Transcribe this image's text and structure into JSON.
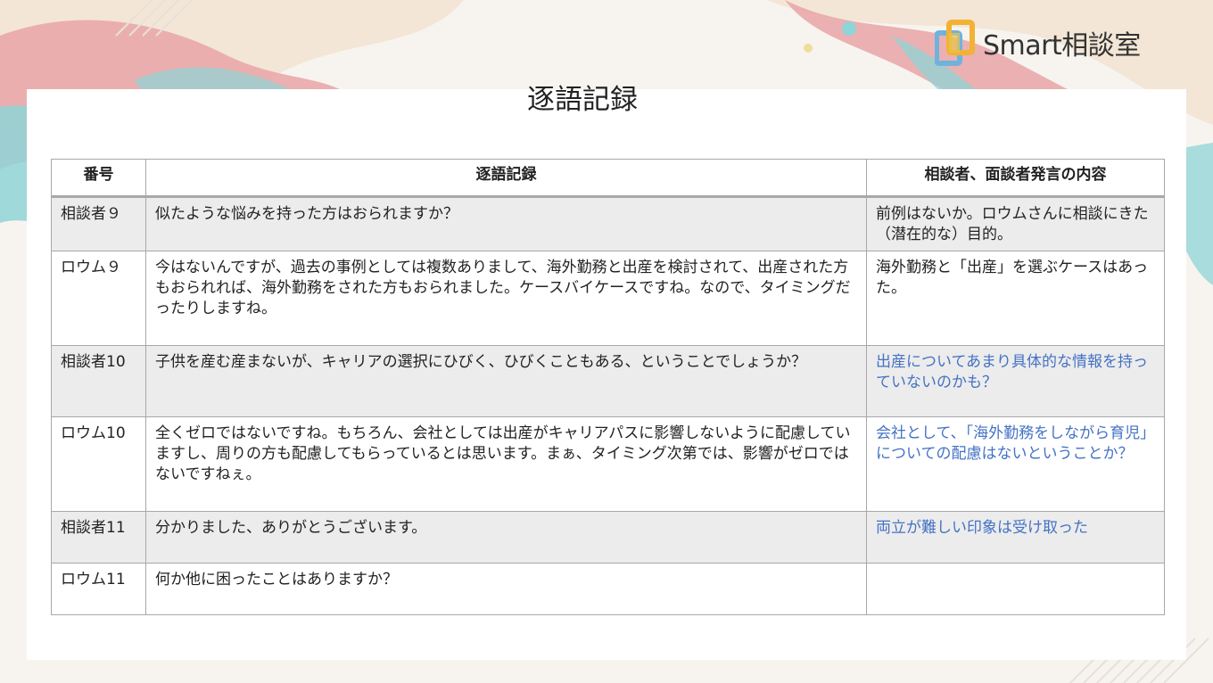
{
  "brand": {
    "name": "Smart相談室"
  },
  "page": {
    "title": "逐語記録"
  },
  "table": {
    "headers": [
      "番号",
      "逐語記録",
      "相談者、面談者発言の内容"
    ],
    "rows": [
      {
        "id": "相談者９",
        "text": "似たような悩みを持った方はおられますか？",
        "note": "前例はないか。ロウムさんに相談にきた（潜在的な）目的。",
        "note_color": "#222222",
        "shaded": true
      },
      {
        "id": "ロウム９",
        "text": "今はないんですが、過去の事例としては複数ありまして、海外勤務と出産を検討されて、出産された方もおられれば、海外勤務をされた方もおられました。ケースバイケースですね。なので、タイミングだったりしますね。",
        "note": "海外勤務と「出産」を選ぶケースはあった。",
        "note_color": "#222222",
        "shaded": false
      },
      {
        "id": "相談者10",
        "text": "子供を産む産まないが、キャリアの選択にひびく、ひびくこともある、ということでしょうか？",
        "note": "出産についてあまり具体的な情報を持っていないのかも？",
        "note_color": "#4472c4",
        "shaded": true
      },
      {
        "id": "ロウム10",
        "text": "全くゼロではないですね。もちろん、会社としては出産がキャリアパスに影響しないように配慮していますし、周りの方も配慮してもらっているとは思います。まぁ、タイミング次第では、影響がゼロではないですねぇ。",
        "note": "会社として、「海外勤務をしながら育児」についての配慮はないということか？",
        "note_color": "#4472c4",
        "shaded": false
      },
      {
        "id": "相談者11",
        "text": "分かりました、ありがとうございます。",
        "note": "両立が難しい印象は受け取った",
        "note_color": "#4472c4",
        "shaded": true
      },
      {
        "id": "ロウム11",
        "text": "何か他に困ったことはありますか？",
        "note": "",
        "note_color": "#222222",
        "shaded": false
      }
    ]
  }
}
